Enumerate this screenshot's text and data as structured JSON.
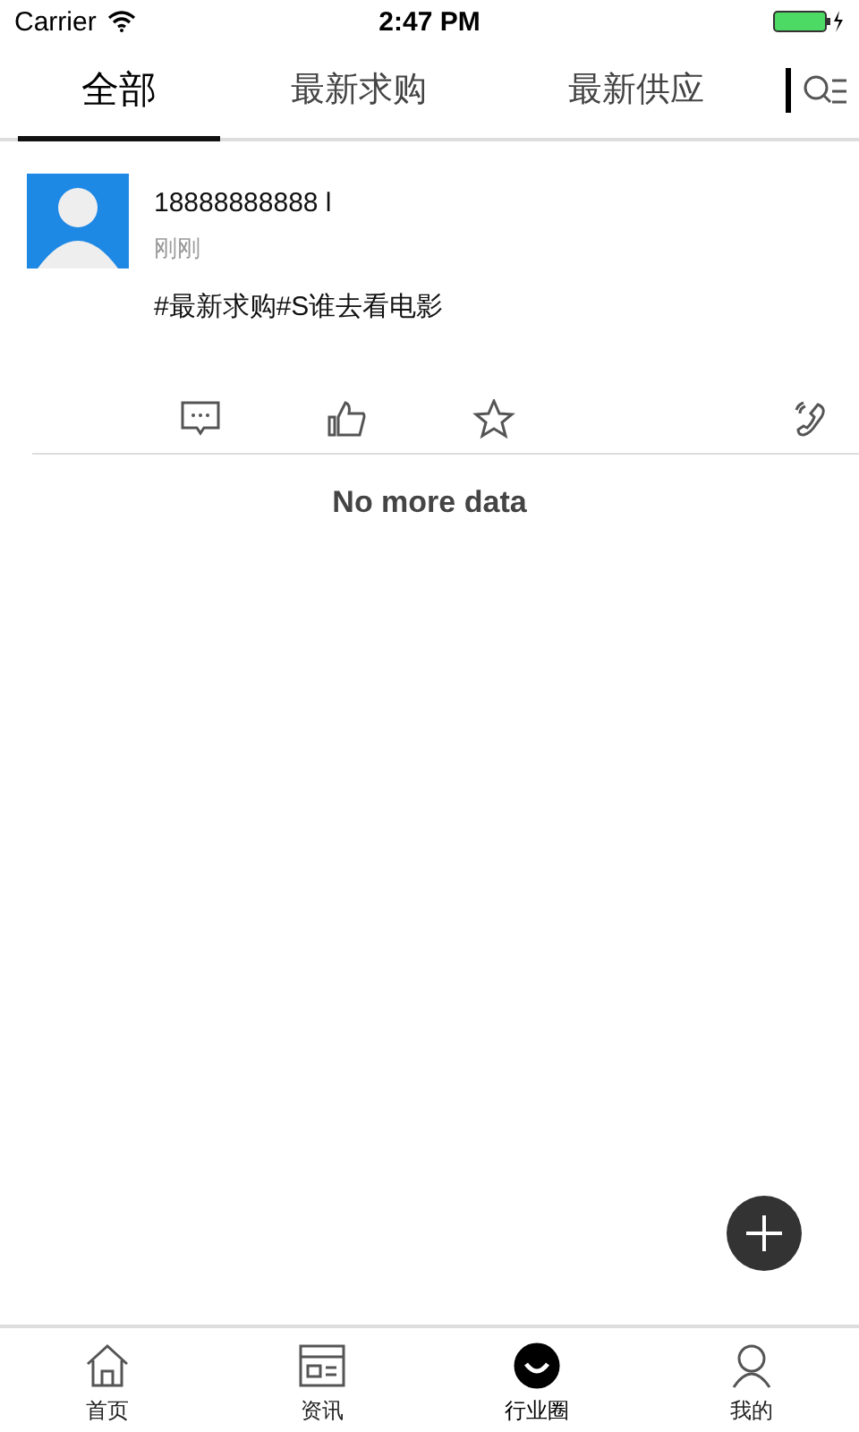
{
  "status_bar": {
    "carrier": "Carrier",
    "time": "2:47 PM"
  },
  "tabs": [
    {
      "label": "全部",
      "selected": true
    },
    {
      "label": "最新求购",
      "selected": false
    },
    {
      "label": "最新供应",
      "selected": false
    }
  ],
  "post": {
    "author": "18888888888 l",
    "time": "刚刚",
    "text": "#最新求购#S谁去看电影"
  },
  "footer_note": "No more data",
  "bottom_nav": [
    {
      "label": "首页",
      "kind": "home",
      "selected": false
    },
    {
      "label": "资讯",
      "kind": "news",
      "selected": false
    },
    {
      "label": "行业圈",
      "kind": "circle",
      "selected": true
    },
    {
      "label": "我的",
      "kind": "profile",
      "selected": false
    }
  ]
}
